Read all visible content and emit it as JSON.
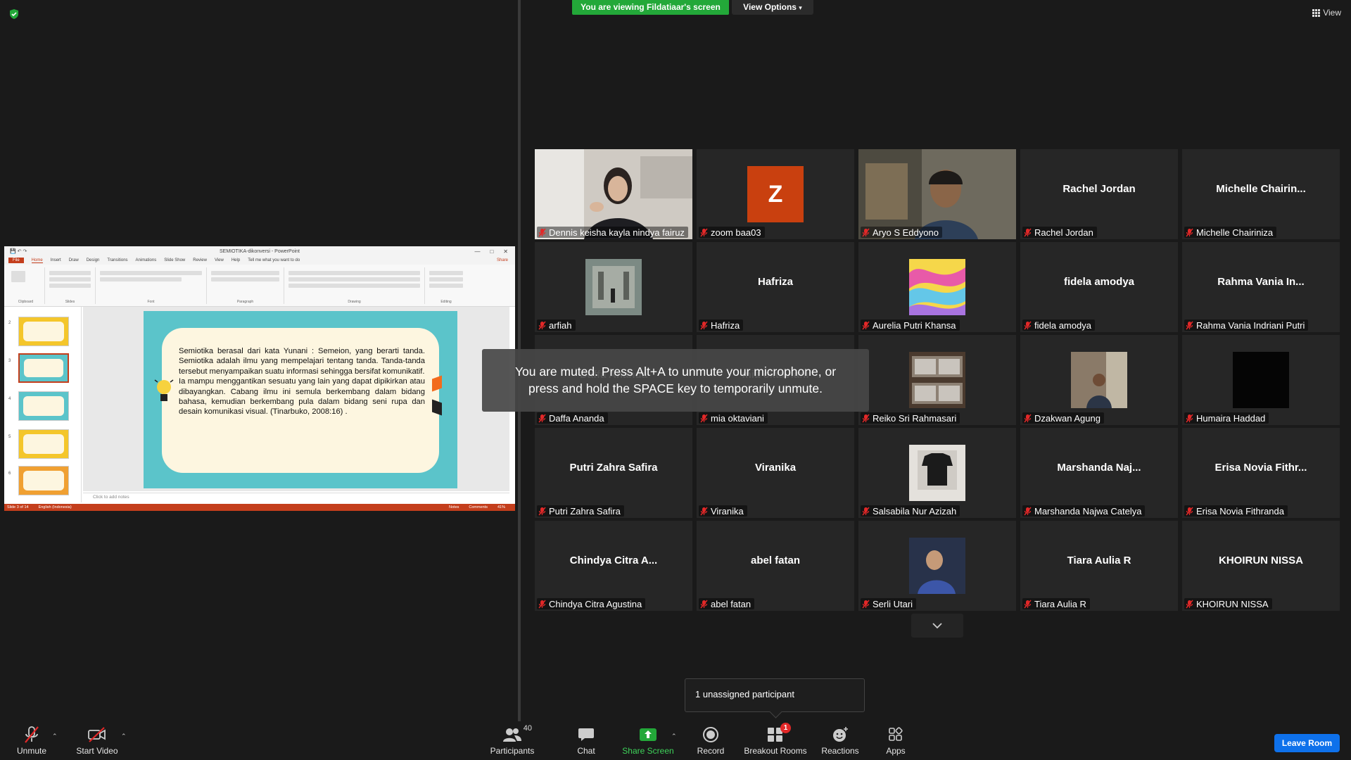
{
  "top": {
    "viewing_banner": "You are viewing Fildatiaar's screen",
    "view_options": "View Options",
    "view": "View"
  },
  "powerpoint": {
    "title": "SEMIOTIKA-dikonversi  -  PowerPoint",
    "tabs": [
      "File",
      "Home",
      "Insert",
      "Draw",
      "Design",
      "Transitions",
      "Animations",
      "Slide Show",
      "Review",
      "View",
      "Help"
    ],
    "tell_me": "Tell me what you want to do",
    "share": "Share",
    "ribbon_groups": [
      "Clipboard",
      "Slides",
      "Font",
      "Paragraph",
      "Drawing",
      "Editing"
    ],
    "slide_text_1": "Semiotika berasal dari kata Yunani : Semeion, yang berarti tanda. Semiotika adalah ilmu yang mempelajari tentang tanda. Tanda-tanda tersebut menyampaikan suatu informasi sehingga bersifat komunikatif.",
    "slide_text_2": "Ia mampu menggantikan sesuatu yang lain yang dapat dipikirkan atau dibayangkan. Cabang ilmu ini semula berkembang dalam bidang bahasa, kemudian berkembang pula dalam bidang seni rupa dan desain komunikasi visual. (Tinarbuko, 2008:16) .",
    "notes_placeholder": "Click to add notes",
    "status_slide": "Slide 3 of 14",
    "status_lang": "English (Indonesia)",
    "status_notes": "Notes",
    "status_comments": "Comments",
    "status_zoom": "41%",
    "thumb_numbers": [
      "2",
      "3",
      "4",
      "5",
      "6"
    ]
  },
  "participants": [
    {
      "label": "Dennis keisha kayla nindya fairuz",
      "name": ""
    },
    {
      "label": "zoom baa03",
      "name": "",
      "letter": "Z"
    },
    {
      "label": "Aryo S Eddyono",
      "name": ""
    },
    {
      "label": "Rachel Jordan",
      "name": "Rachel Jordan"
    },
    {
      "label": "Michelle Chairiniza",
      "name": "Michelle  Chairin..."
    },
    {
      "label": "arfiah",
      "name": ""
    },
    {
      "label": "Hafriza",
      "name": "Hafriza"
    },
    {
      "label": "Aurelia Putri Khansa",
      "name": ""
    },
    {
      "label": "fidela amodya",
      "name": "fidela amodya"
    },
    {
      "label": "Rahma Vania Indriani Putri",
      "name": "Rahma Vania In..."
    },
    {
      "label": "Daffa Ananda",
      "name": "Daffa Ananda"
    },
    {
      "label": "mia oktaviani",
      "name": "mia oktaviani"
    },
    {
      "label": "Reiko Sri Rahmasari",
      "name": ""
    },
    {
      "label": "Dzakwan Agung",
      "name": ""
    },
    {
      "label": "Humaira Haddad",
      "name": ""
    },
    {
      "label": "Putri Zahra Safira",
      "name": "Putri Zahra Safira"
    },
    {
      "label": "Viranika",
      "name": "Viranika"
    },
    {
      "label": "Salsabila Nur Azizah",
      "name": ""
    },
    {
      "label": "Marshanda Najwa Catelya",
      "name": "Marshanda  Naj..."
    },
    {
      "label": "Erisa Novia Fithranda",
      "name": "Erisa Novia Fithr..."
    },
    {
      "label": "Chindya Citra Agustina",
      "name": "Chindya  Citra  A..."
    },
    {
      "label": "abel fatan",
      "name": "abel fatan"
    },
    {
      "label": "Serli Utari",
      "name": ""
    },
    {
      "label": "Tiara Aulia R",
      "name": "Tiara Aulia R"
    },
    {
      "label": "KHOIRUN NISSA",
      "name": "KHOIRUN NISSA"
    }
  ],
  "mute_toast": {
    "line1": "You are muted. Press Alt+A to unmute your microphone, or",
    "line2": "press and hold the SPACE key to temporarily unmute."
  },
  "unassigned": "1 unassigned participant",
  "toolbar": {
    "unmute": "Unmute",
    "start_video": "Start Video",
    "participants": "Participants",
    "participants_count": "40",
    "chat": "Chat",
    "share_screen": "Share Screen",
    "record": "Record",
    "breakout_rooms": "Breakout Rooms",
    "breakout_badge": "1",
    "reactions": "Reactions",
    "apps": "Apps",
    "leave_room": "Leave Room"
  },
  "colors": {
    "banner_green": "#23a839",
    "active_speaker": "#e7e27c",
    "leave_blue": "#0e71eb",
    "mute_red": "#e22828",
    "powerpoint_red": "#c43e1c",
    "slide_teal": "#5bc4ca"
  }
}
